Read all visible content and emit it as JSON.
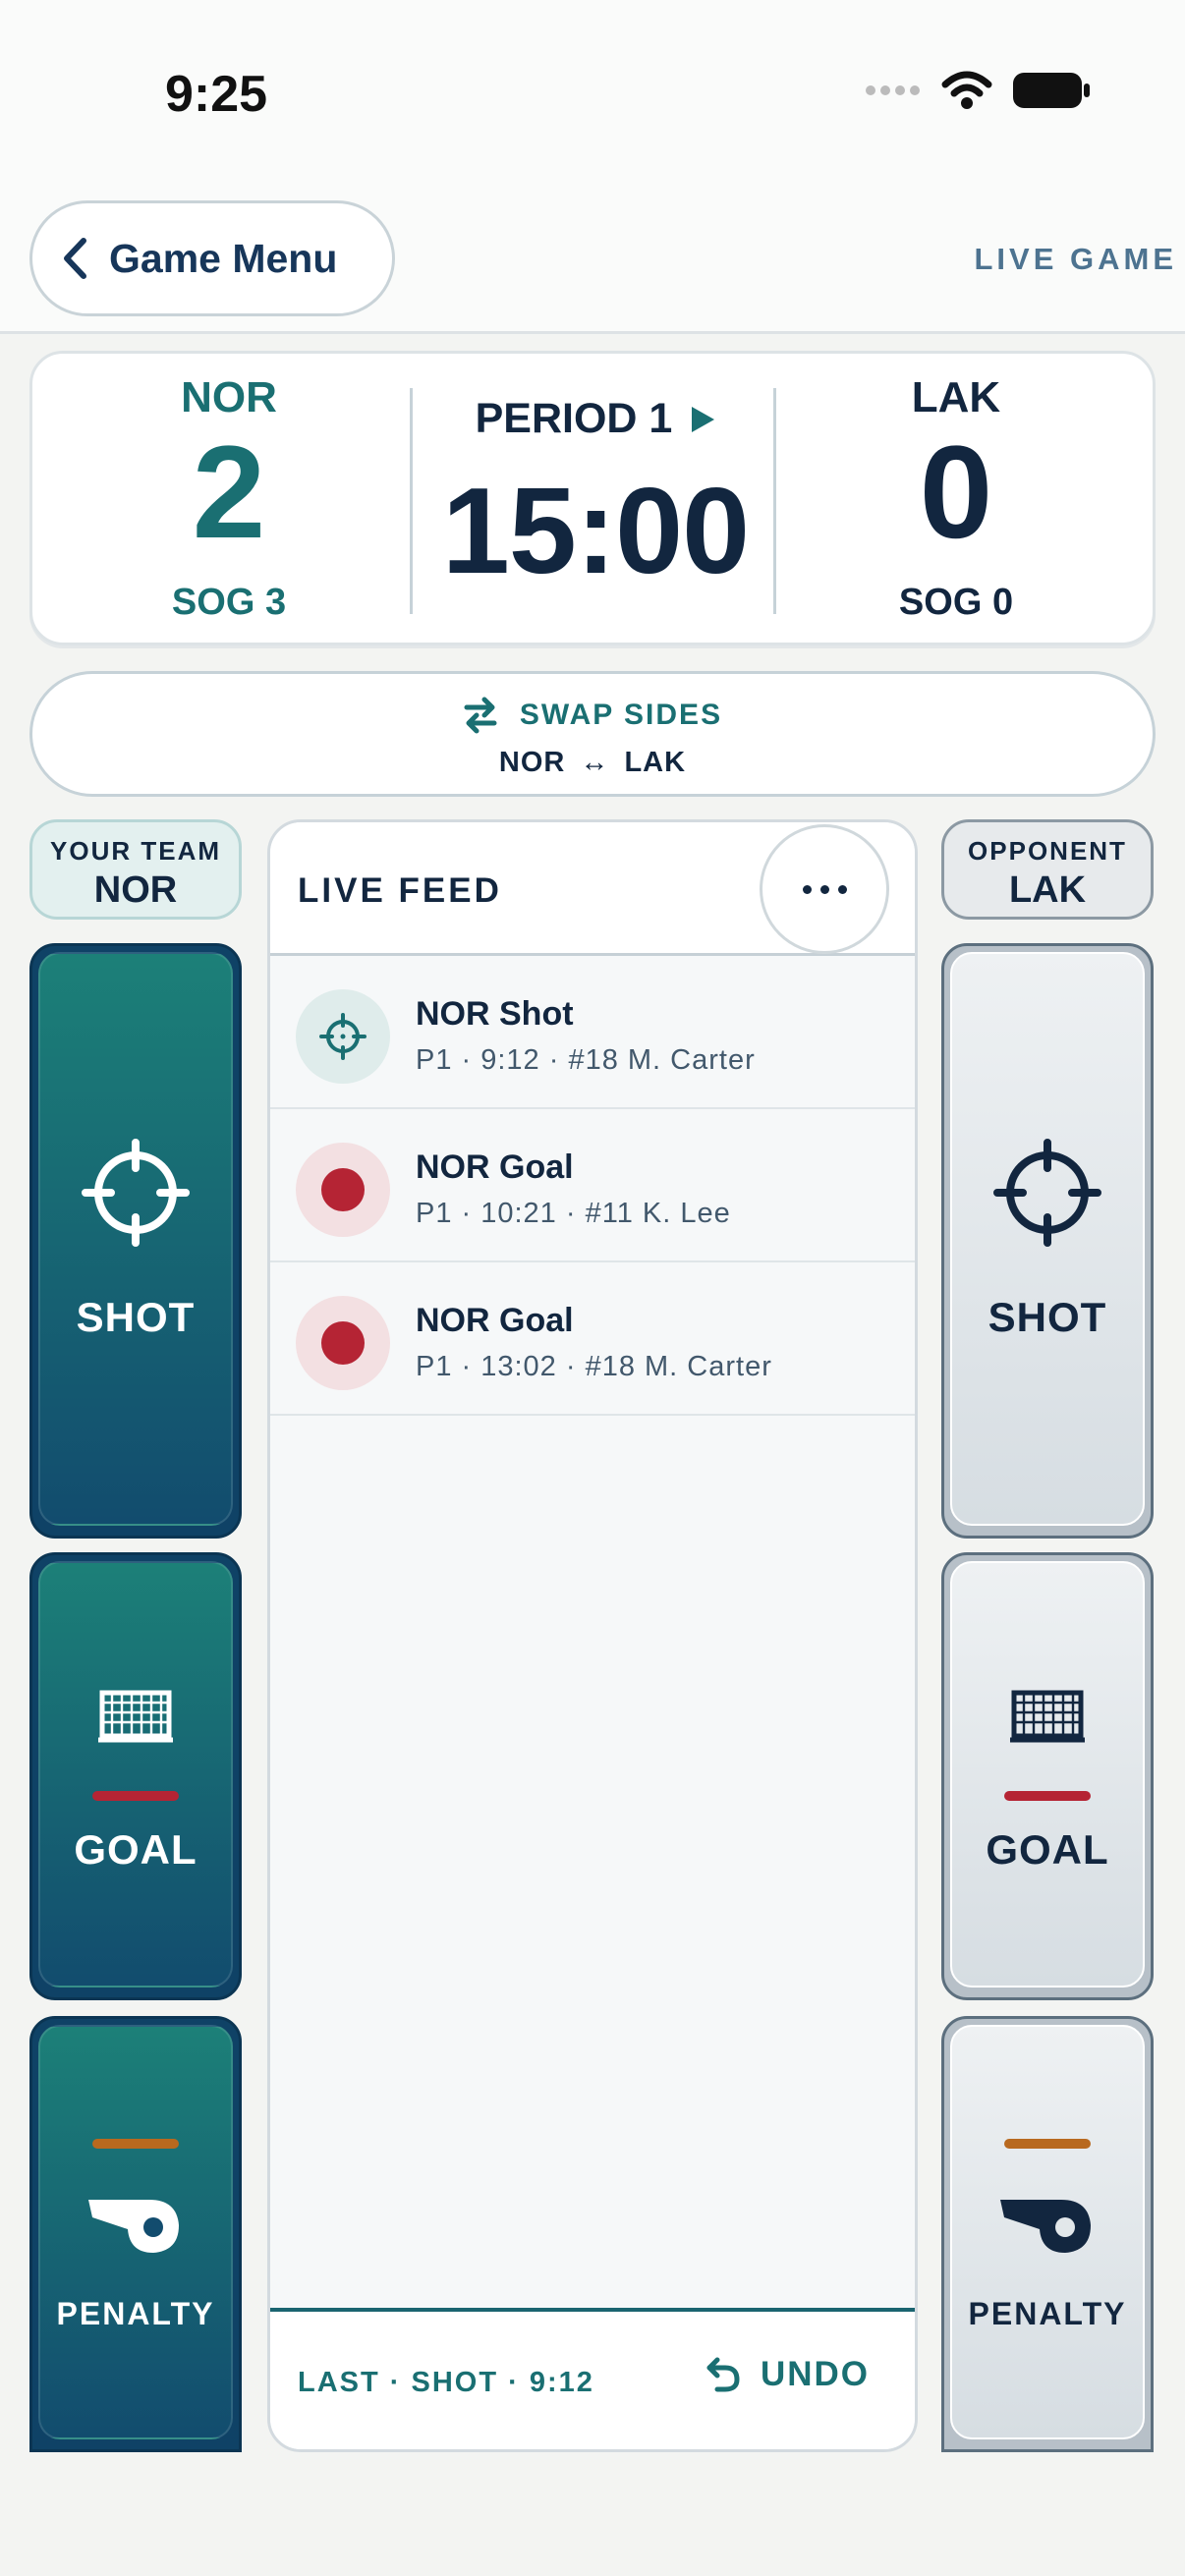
{
  "status_bar": {
    "time": "9:25"
  },
  "nav": {
    "back_label": "Game Menu",
    "title": "LIVE GAME"
  },
  "scoreboard": {
    "home": {
      "abbr": "NOR",
      "score": "2",
      "sog": "SOG 3"
    },
    "away": {
      "abbr": "LAK",
      "score": "0",
      "sog": "SOG 0"
    },
    "period": "PERIOD 1",
    "clock": "15:00"
  },
  "swap": {
    "label": "SWAP SIDES",
    "sub": "NOR ↔ LAK"
  },
  "left_team": {
    "caption": "YOUR TEAM",
    "team": "NOR"
  },
  "right_team": {
    "caption": "OPPONENT",
    "team": "LAK"
  },
  "actions": {
    "shot": "SHOT",
    "goal": "GOAL",
    "penalty": "PENALTY"
  },
  "feed": {
    "title": "LIVE FEED",
    "items": [
      {
        "type": "shot",
        "title": "NOR Shot",
        "detail": "P1 · 9:12 · #18 M. Carter"
      },
      {
        "type": "goal",
        "title": "NOR Goal",
        "detail": "P1 · 10:21 · #11 K. Lee"
      },
      {
        "type": "goal",
        "title": "NOR Goal",
        "detail": "P1 · 13:02 · #18 M. Carter"
      }
    ],
    "last": "LAST · SHOT · 9:12",
    "undo": "UNDO"
  },
  "colors": {
    "teal": "#1a6f72",
    "navy": "#12263f",
    "goal_red": "#b52434",
    "penalty_orange": "#b8691f"
  },
  "icons": [
    "chevron-left-icon",
    "play-icon",
    "swap-icon",
    "crosshair-icon",
    "goal-net-icon",
    "whistle-icon",
    "more-icon",
    "undo-icon",
    "wifi-icon",
    "battery-icon",
    "signal-icon"
  ]
}
